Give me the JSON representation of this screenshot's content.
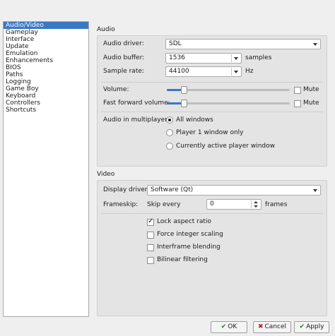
{
  "sidebar": {
    "items": [
      {
        "label": "Audio/Video"
      },
      {
        "label": "Gameplay"
      },
      {
        "label": "Interface"
      },
      {
        "label": "Update"
      },
      {
        "label": "Emulation"
      },
      {
        "label": "Enhancements"
      },
      {
        "label": "BIOS"
      },
      {
        "label": "Paths"
      },
      {
        "label": "Logging"
      },
      {
        "label": "Game Boy"
      },
      {
        "label": "Keyboard"
      },
      {
        "label": "Controllers"
      },
      {
        "label": "Shortcuts"
      }
    ],
    "selected_index": 0,
    "selected_color": "#3a78c2"
  },
  "audio": {
    "section_title": "Audio",
    "driver_label": "Audio driver:",
    "driver_value": "SDL",
    "buffer_label": "Audio buffer:",
    "buffer_value": "1536",
    "buffer_unit": "samples",
    "rate_label": "Sample rate:",
    "rate_value": "44100",
    "rate_unit": "Hz",
    "volume_label": "Volume:",
    "volume_level": 0.14,
    "mute_label": "Mute",
    "volume_muted": false,
    "ff_volume_label": "Fast forward volume:",
    "ff_volume_level": 0.14,
    "ff_mute_label": "Mute",
    "ff_muted": false,
    "multiplayer_label": "Audio in multiplayer:",
    "multiplayer_options": [
      "All windows",
      "Player 1 window only",
      "Currently active player window"
    ],
    "multiplayer_selected": 0
  },
  "video": {
    "section_title": "Video",
    "driver_label": "Display driver:",
    "driver_value": "Software (Qt)",
    "frameskip_label": "Frameskip:",
    "skip_every_label": "Skip every",
    "frameskip_value": "0",
    "frames_unit": "frames",
    "options": [
      {
        "label": "Lock aspect ratio",
        "checked": true
      },
      {
        "label": "Force integer scaling",
        "checked": false
      },
      {
        "label": "Interframe blending",
        "checked": false
      },
      {
        "label": "Bilinear filtering",
        "checked": false
      }
    ]
  },
  "buttons": {
    "ok_label": "OK",
    "cancel_label": "Cancel",
    "apply_label": "Apply"
  }
}
